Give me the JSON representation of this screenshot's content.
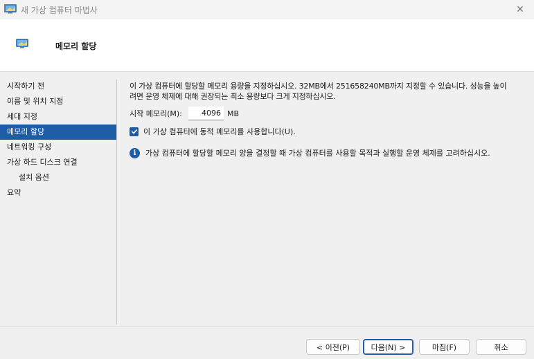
{
  "window": {
    "title": "새 가상 컴퓨터 마법사"
  },
  "header": {
    "title": "메모리 할당"
  },
  "sidebar": {
    "items": [
      {
        "label": "시작하기 전"
      },
      {
        "label": "이름 및 위치 지정"
      },
      {
        "label": "세대 지정"
      },
      {
        "label": "메모리 할당"
      },
      {
        "label": "네트워킹 구성"
      },
      {
        "label": "가상 하드 디스크 연결"
      },
      {
        "label": "설치 옵션"
      },
      {
        "label": "요약"
      }
    ],
    "active_index": 3
  },
  "main": {
    "description_line1": "이 가상 컴퓨터에 할당할 메모리 용량을 지정하십시오. 32MB에서 251658240MB까지 지정할 수 있습니다. 성능을 높이",
    "description_line2": "려면 운영 체제에 대해 권장되는 최소 용량보다 크게 지정하십시오.",
    "startup_memory_label": "시작 메모리(M):",
    "startup_memory_value": "4096",
    "startup_memory_unit": "MB",
    "dynamic_memory_label": "이 가상 컴퓨터에 동적 메모리를 사용합니다(U).",
    "dynamic_memory_checked": true,
    "info_text": "가상 컴퓨터에 할당할 메모리 양을 결정할 때 가상 컴퓨터를 사용할 목적과 실행할 운영 체제를 고려하십시오."
  },
  "footer": {
    "prev_label": "< 이전(P)",
    "next_label": "다음(N) >",
    "finish_label": "마침(F)",
    "cancel_label": "취소"
  },
  "icons": {
    "app": "monitor-icon",
    "close": "close-icon",
    "check": "check-icon",
    "info": "info-icon"
  },
  "colors": {
    "accent": "#1f5ca6",
    "header_bg": "#ffffff",
    "body_bg": "#f0f0f0"
  }
}
